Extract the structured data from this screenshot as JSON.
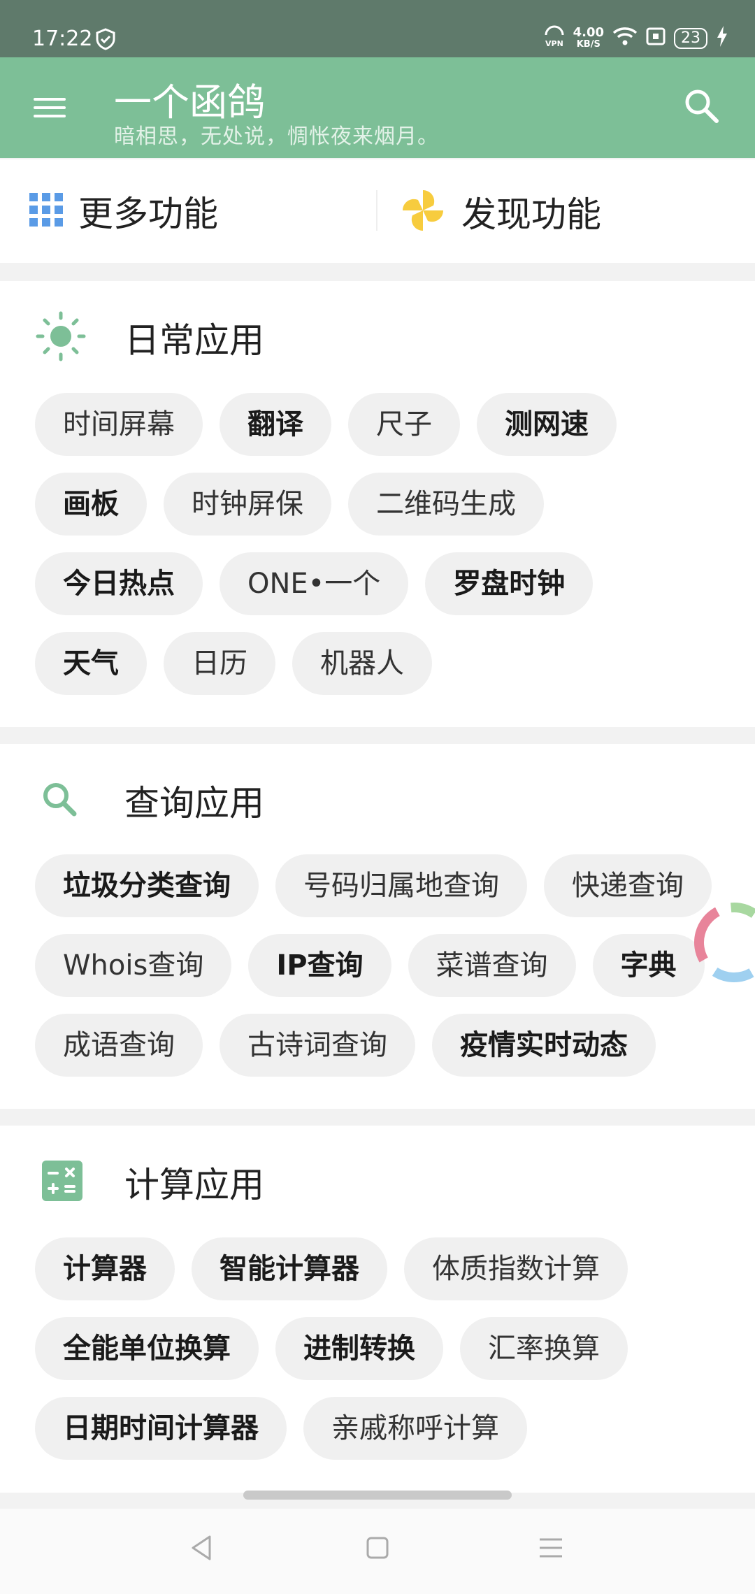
{
  "status": {
    "time": "17:22",
    "speed_value": "4.00",
    "speed_unit": "KB/S",
    "battery": "23",
    "vpn_label": "VPN"
  },
  "appbar": {
    "title": "一个函鸽",
    "subtitle": "暗相思，无处说，惆怅夜来烟月。"
  },
  "top": {
    "more_label": "更多功能",
    "discover_label": "发现功能"
  },
  "sections": [
    {
      "title": "日常应用",
      "rows": [
        [
          {
            "label": "时间屏幕",
            "bold": false
          },
          {
            "label": "翻译",
            "bold": true
          },
          {
            "label": "尺子",
            "bold": false
          },
          {
            "label": "测网速",
            "bold": true
          }
        ],
        [
          {
            "label": "画板",
            "bold": true
          },
          {
            "label": "时钟屏保",
            "bold": false
          },
          {
            "label": "二维码生成",
            "bold": false
          }
        ],
        [
          {
            "label": "今日热点",
            "bold": true
          },
          {
            "label": "ONE•一个",
            "bold": false
          },
          {
            "label": "罗盘时钟",
            "bold": true
          }
        ],
        [
          {
            "label": "天气",
            "bold": true
          },
          {
            "label": "日历",
            "bold": false
          },
          {
            "label": "机器人",
            "bold": false
          }
        ]
      ]
    },
    {
      "title": "查询应用",
      "rows": [
        [
          {
            "label": "垃圾分类查询",
            "bold": true
          },
          {
            "label": "号码归属地查询",
            "bold": false
          },
          {
            "label": "快递查询",
            "bold": false
          }
        ],
        [
          {
            "label": "Whois查询",
            "bold": false
          },
          {
            "label": "IP查询",
            "bold": true
          },
          {
            "label": "菜谱查询",
            "bold": false
          },
          {
            "label": "字典",
            "bold": true
          }
        ],
        [
          {
            "label": "成语查询",
            "bold": false
          },
          {
            "label": "古诗词查询",
            "bold": false
          },
          {
            "label": "疫情实时动态",
            "bold": true
          }
        ]
      ]
    },
    {
      "title": "计算应用",
      "rows": [
        [
          {
            "label": "计算器",
            "bold": true
          },
          {
            "label": "智能计算器",
            "bold": true
          },
          {
            "label": "体质指数计算",
            "bold": false
          }
        ],
        [
          {
            "label": "全能单位换算",
            "bold": true
          },
          {
            "label": "进制转换",
            "bold": true
          },
          {
            "label": "汇率换算",
            "bold": false
          }
        ],
        [
          {
            "label": "日期时间计算器",
            "bold": true
          },
          {
            "label": "亲戚称呼计算",
            "bold": false
          }
        ]
      ]
    }
  ],
  "colors": {
    "accent": "#7dbf97",
    "status_bar": "#5f7a6b",
    "chip_bg": "#f0f0f0",
    "sun": "#7dbf97",
    "calc": "#7dbf97"
  }
}
